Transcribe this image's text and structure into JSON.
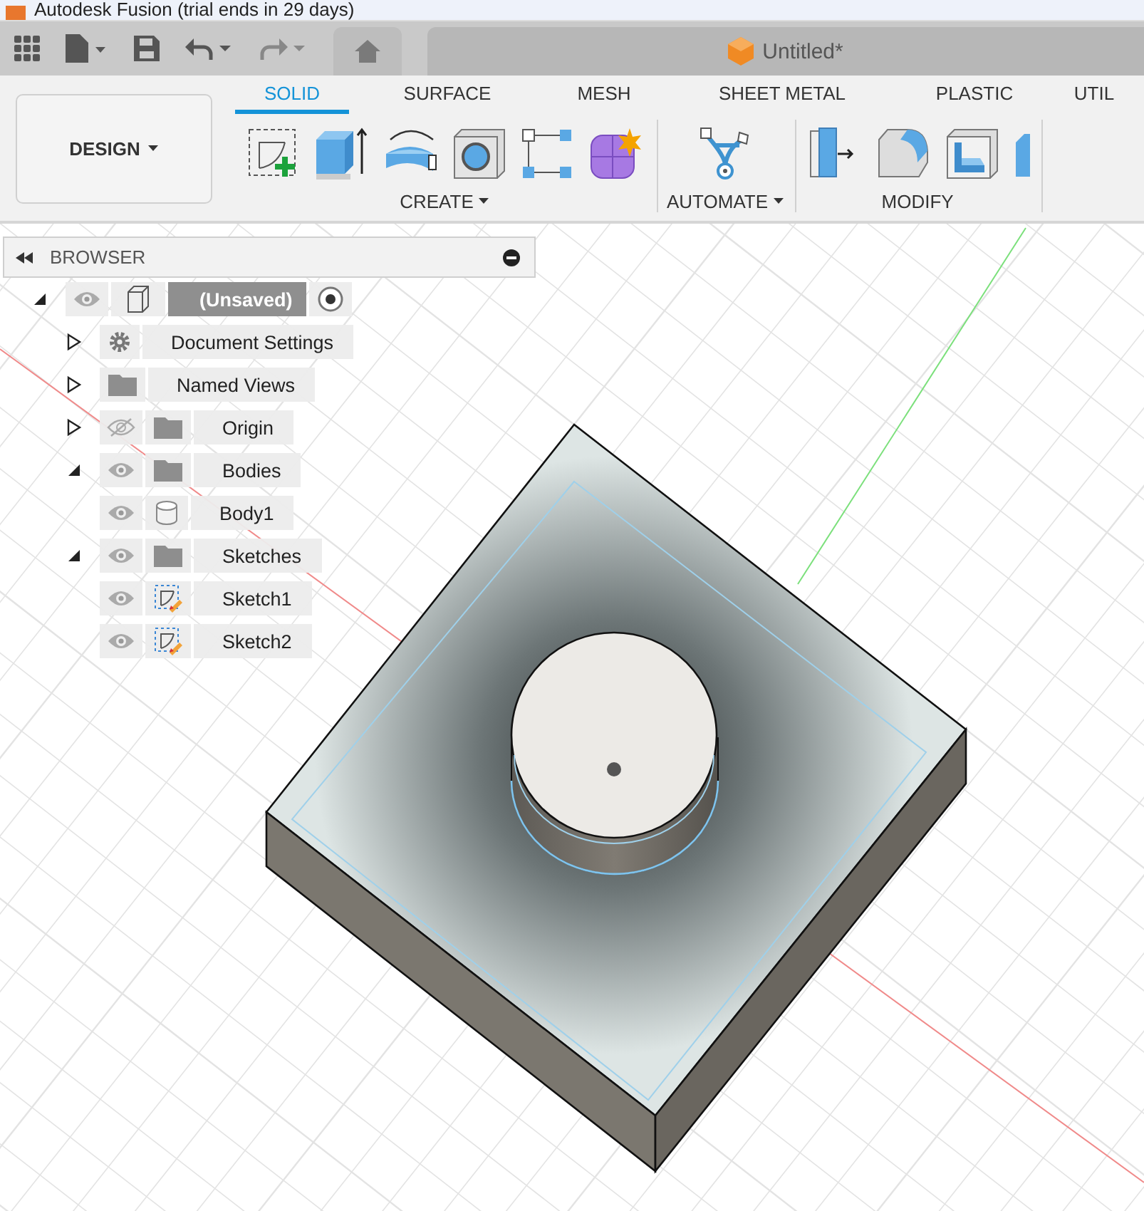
{
  "window": {
    "title": "Autodesk Fusion (trial ends in 29 days)"
  },
  "document_tab": {
    "title": "Untitled*"
  },
  "workspace": {
    "label": "DESIGN"
  },
  "ribbon": {
    "tabs": [
      {
        "label": "SOLID",
        "selected": true
      },
      {
        "label": "SURFACE",
        "selected": false
      },
      {
        "label": "MESH",
        "selected": false
      },
      {
        "label": "SHEET METAL",
        "selected": false
      },
      {
        "label": "PLASTIC",
        "selected": false
      },
      {
        "label": "UTIL",
        "selected": false
      }
    ],
    "groups": [
      {
        "label": "CREATE",
        "tools": [
          {
            "kind": "sketch"
          },
          {
            "kind": "extrude"
          },
          {
            "kind": "revolve"
          },
          {
            "kind": "hole"
          },
          {
            "kind": "pattern"
          },
          {
            "kind": "form"
          }
        ]
      },
      {
        "label": "AUTOMATE",
        "tools": [
          {
            "kind": "automate"
          }
        ]
      },
      {
        "label": "MODIFY",
        "tools": [
          {
            "kind": "presspull"
          },
          {
            "kind": "fillet"
          },
          {
            "kind": "shell"
          },
          {
            "kind": "partial"
          }
        ]
      }
    ]
  },
  "browser": {
    "title": "BROWSER",
    "tree": [
      {
        "label": "(Unsaved)",
        "kind": "component",
        "selected": true,
        "expanded": true,
        "visible": true,
        "children": [
          {
            "label": "Document Settings",
            "kind": "settings",
            "selected": false,
            "expanded": false
          },
          {
            "label": "Named Views",
            "kind": "folder",
            "selected": false,
            "expanded": false
          },
          {
            "label": "Origin",
            "kind": "folder",
            "selected": false,
            "expanded": false,
            "visible": false
          },
          {
            "label": "Bodies",
            "kind": "folder",
            "selected": false,
            "expanded": true,
            "visible": true,
            "children": [
              {
                "label": "Body1",
                "kind": "body",
                "selected": false,
                "visible": true
              }
            ]
          },
          {
            "label": "Sketches",
            "kind": "folder",
            "selected": false,
            "expanded": true,
            "visible": true,
            "children": [
              {
                "label": "Sketch1",
                "kind": "sketch",
                "selected": false,
                "visible": true
              },
              {
                "label": "Sketch2",
                "kind": "sketch",
                "selected": false,
                "visible": true
              }
            ]
          }
        ]
      }
    ]
  }
}
